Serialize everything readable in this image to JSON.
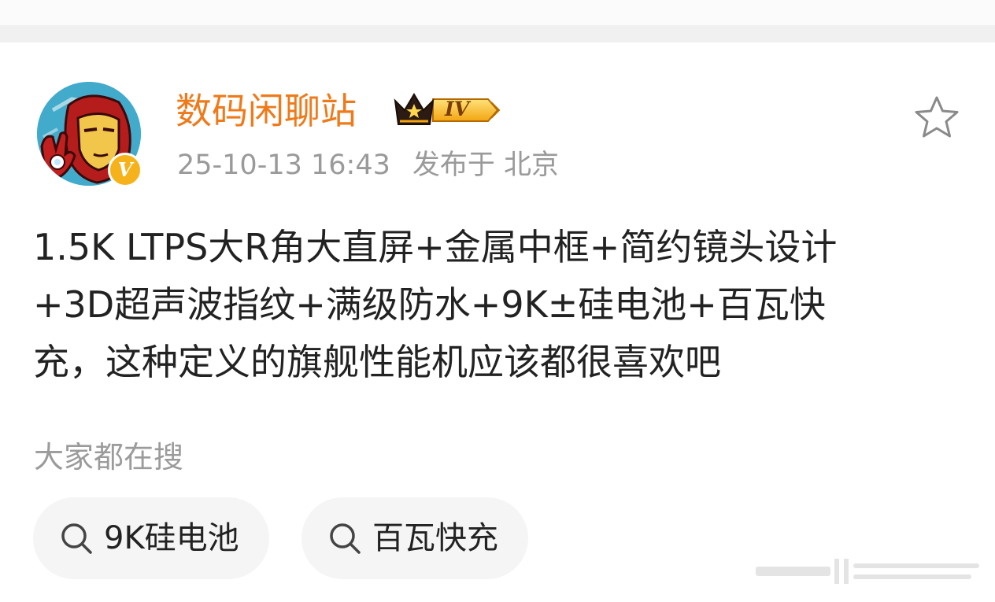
{
  "author": {
    "name": "数码闲聊站",
    "level_badge": "IV",
    "verified_mark": "V",
    "timestamp": "25-10-13 16:43",
    "location": "发布于 北京"
  },
  "post": {
    "lines": [
      "1.5K LTPS大R角大直屏+金属中框+简约镜头设计",
      "+3D超声波指纹+满级防水+9K±硅电池+百瓦快",
      "充，这种定义的旗舰性能机应该都很喜欢吧"
    ]
  },
  "search_section": {
    "heading": "大家都在搜",
    "chips": [
      {
        "label": "9K硅电池",
        "icon": "search-icon"
      },
      {
        "label": "百瓦快充",
        "icon": "search-icon"
      }
    ]
  },
  "icons": {
    "favorite": "star-outline-icon",
    "verified": "verified-badge-icon",
    "level": "crown-icon"
  },
  "colors": {
    "username": "#ef7a1a",
    "meta": "#9a9a9a",
    "body_text": "#222222",
    "verified_badge": "#f6b21a",
    "chip_background": "#f5f5f5"
  }
}
